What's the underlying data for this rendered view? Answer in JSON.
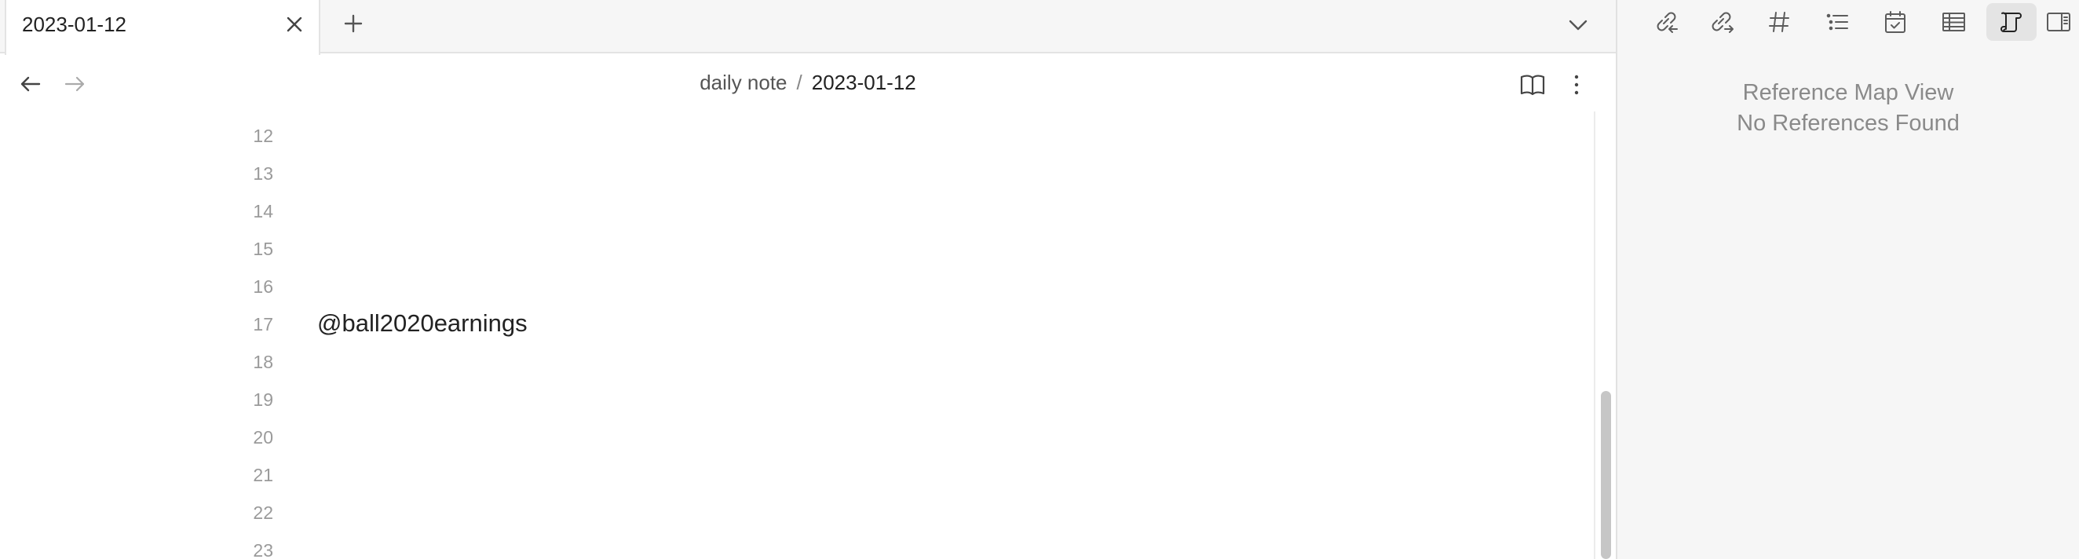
{
  "tabs": [
    {
      "title": "2023-01-12"
    }
  ],
  "header": {
    "breadcrumb_folder": "daily note",
    "breadcrumb_separator": "/",
    "breadcrumb_file": "2023-01-12"
  },
  "editor": {
    "lines": [
      {
        "num": "12",
        "text": ""
      },
      {
        "num": "13",
        "text": ""
      },
      {
        "num": "14",
        "text": ""
      },
      {
        "num": "15",
        "text": ""
      },
      {
        "num": "16",
        "text": ""
      },
      {
        "num": "17",
        "text": "@ball2020earnings"
      },
      {
        "num": "18",
        "text": ""
      },
      {
        "num": "19",
        "text": ""
      },
      {
        "num": "20",
        "text": ""
      },
      {
        "num": "21",
        "text": ""
      },
      {
        "num": "22",
        "text": ""
      },
      {
        "num": "23",
        "text": ""
      }
    ]
  },
  "sidebar": {
    "tab_icons": [
      "backlinks-icon",
      "outgoing-links-icon",
      "tags-icon",
      "outline-icon",
      "calendar-icon",
      "table-icon",
      "reference-map-icon",
      "toggle-sidebar-icon"
    ],
    "active_tab": "reference-map-icon",
    "panel_title": "Reference Map View",
    "panel_message": "No References Found"
  },
  "colors": {
    "sidebar_bg": "#f6f6f6",
    "tabbar_bg": "#f6f6f6",
    "line_number": "#9a9a9a",
    "panel_text": "#8a8a8a",
    "active_tab_bg": "#e4e4e4"
  }
}
